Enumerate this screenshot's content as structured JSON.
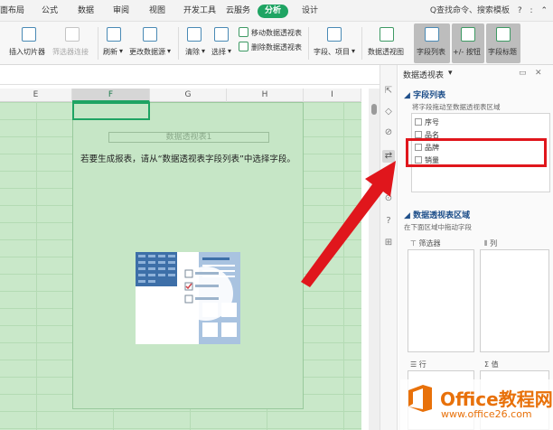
{
  "menu": {
    "items": [
      "面布局",
      "公式",
      "数据",
      "审阅",
      "视图",
      "开发工具",
      "云服务",
      "分析",
      "设计"
    ],
    "active": "分析",
    "search": "Q查找命令、搜索模板",
    "help": "?",
    "more": ":"
  },
  "ribbon": {
    "insert_slicer": "插入切片器",
    "filter_connection": "筛选器连接",
    "refresh": "刷新",
    "change_source": "更改数据源",
    "clear": "清除",
    "select": "选择",
    "move_pivot": "移动数据透视表",
    "delete_pivot": "删除数据透视表",
    "fields_items": "字段、项目",
    "pivot_chart": "数据透视图",
    "field_list": "字段列表",
    "plus_minus": "+/- 按钮",
    "field_headers": "字段标题"
  },
  "sheet": {
    "columns": [
      "E",
      "F",
      "G",
      "H",
      "I"
    ],
    "selected_column": "F",
    "pivot_title": "数据透视表1",
    "message": "若要生成报表，请从“数据透视表字段列表”中选择字段。"
  },
  "pane": {
    "title": "数据透视表",
    "field_list_heading": "字段列表",
    "field_list_sub": "将字段拖动至数据透视表区域",
    "fields": [
      "序号",
      "品名",
      "品牌",
      "销量"
    ],
    "areas_heading": "数据透视表区域",
    "areas_sub": "在下面区域中拖动字段",
    "filter_label": "筛选器",
    "column_label": "列",
    "row_label": "行",
    "value_label": "值"
  },
  "watermark": {
    "brand": "Office教程网",
    "url": "www.office26.com"
  },
  "colors": {
    "accent": "#1fa463",
    "sheet_bg": "#c9e8c9",
    "highlight": "#e0161c",
    "heading": "#1e4f8a",
    "watermark": "#e8710a"
  }
}
